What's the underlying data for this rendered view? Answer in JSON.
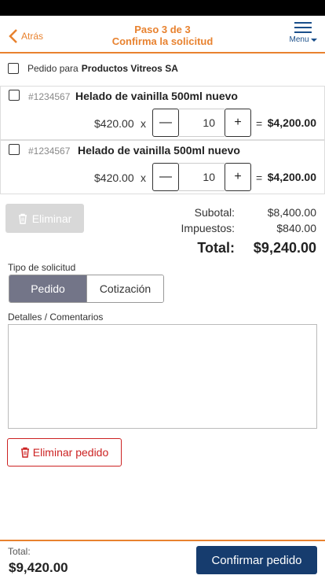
{
  "header": {
    "back_label": "Atrás",
    "step": "Paso 3 de 3",
    "title": "Confirma la solicitud",
    "menu_label": "Menu"
  },
  "order_for": {
    "label": "Pedido para",
    "company": "Productos Vitreos SA"
  },
  "items": [
    {
      "sku": "#1234567",
      "name": "Helado de vainilla 500ml nuevo",
      "price": "$420.00",
      "x": "x",
      "minus": "—",
      "qty": "10",
      "plus": "+",
      "eq": "=",
      "total": "$4,200.00"
    },
    {
      "sku": "#1234567",
      "name": "Helado de vainilla 500ml nuevo",
      "price": "$420.00",
      "x": "x",
      "minus": "—",
      "qty": "10",
      "plus": "+",
      "eq": "=",
      "total": "$4,200.00"
    }
  ],
  "actions": {
    "delete_label": "Eliminar",
    "delete_order_label": "Eliminar pedido"
  },
  "summary": {
    "subtotal_label": "Subotal:",
    "subtotal": "$8,400.00",
    "tax_label": "Impuestos:",
    "tax": "$840.00",
    "total_label": "Total:",
    "total": "$9,240.00"
  },
  "request_type": {
    "label": "Tipo de solicitud",
    "options": [
      "Pedido",
      "Cotización"
    ],
    "selected": "Pedido"
  },
  "details": {
    "label": "Detalles / Comentarios",
    "value": ""
  },
  "footer": {
    "total_label": "Total:",
    "total": "$9,420.00",
    "confirm_label": "Confirmar pedido"
  },
  "colors": {
    "accent": "#e8822f",
    "primary": "#163c6e",
    "danger": "#cc2222",
    "segment_selected": "#737588"
  }
}
